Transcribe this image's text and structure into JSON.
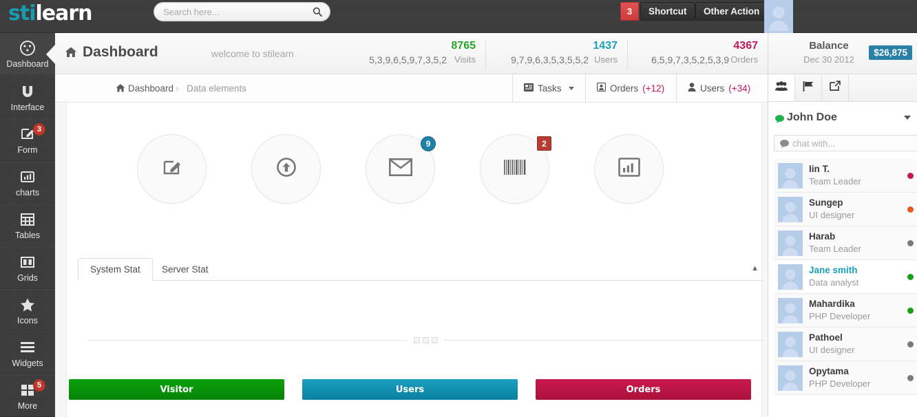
{
  "brand": {
    "part1": "sti",
    "part2": "learn",
    "accent": "#1a9cb0"
  },
  "topbar": {
    "search": {
      "placeholder": "Search here...",
      "value": ""
    },
    "notif_badge": "3",
    "shortcut_label": "Shortcut",
    "other_action_label": "Other Action"
  },
  "sidebar": {
    "items": [
      {
        "label": "Dashboard",
        "icon": "dashboard-icon",
        "badge": "",
        "active": true
      },
      {
        "label": "Interface",
        "icon": "magnet-icon",
        "badge": "",
        "active": false
      },
      {
        "label": "Form",
        "icon": "edit-icon",
        "badge": "3",
        "active": false
      },
      {
        "label": "charts",
        "icon": "bar-chart-icon",
        "badge": "",
        "active": false
      },
      {
        "label": "Tables",
        "icon": "table-icon",
        "badge": "",
        "active": false
      },
      {
        "label": "Grids",
        "icon": "grid-icon",
        "badge": "",
        "active": false
      },
      {
        "label": "Icons",
        "icon": "star-icon",
        "badge": "",
        "active": false
      },
      {
        "label": "Widgets",
        "icon": "list-icon",
        "badge": "",
        "active": false
      },
      {
        "label": "More",
        "icon": "blocks-icon",
        "badge": "5",
        "active": false
      }
    ]
  },
  "header": {
    "title": "Dashboard",
    "subtitle": "welcome to stilearn",
    "stats": [
      {
        "spark": "5,3,9,6,5,9,7,3,5,2",
        "number": "8765",
        "label": "Visits",
        "color": "#28a428"
      },
      {
        "spark": "9,7,9,6,3,5,3,5,5,2",
        "number": "1437",
        "label": "Users",
        "color": "#17a2b8"
      },
      {
        "spark": "6,5,9,7,3,5,2,5,3,9",
        "number": "4367",
        "label": "Orders",
        "color": "#c2185b"
      }
    ]
  },
  "breadcrumb": {
    "root": "Dashboard",
    "separator": "›",
    "current": "Data elements",
    "buttons": [
      {
        "label": "Tasks",
        "count": "",
        "icon": "tasks-icon",
        "caret": true
      },
      {
        "label": "Orders",
        "count": "(+12)",
        "icon": "orders-icon",
        "caret": false
      },
      {
        "label": "Users",
        "count": "(+34)",
        "icon": "user-icon",
        "caret": false
      }
    ]
  },
  "main": {
    "circles": [
      {
        "icon": "edit-square-icon",
        "badge": "",
        "badge_type": ""
      },
      {
        "icon": "upload-circle-icon",
        "badge": "",
        "badge_type": ""
      },
      {
        "icon": "envelope-icon",
        "badge": "9",
        "badge_type": "round"
      },
      {
        "icon": "barcode-icon",
        "badge": "2",
        "badge_type": "square"
      },
      {
        "icon": "chart-icon",
        "badge": "",
        "badge_type": ""
      }
    ],
    "carousel_dots": 3,
    "tabs": [
      {
        "label": "System Stat",
        "active": true
      },
      {
        "label": "Server Stat",
        "active": false
      }
    ],
    "collapse_caret": "▲",
    "buttons": [
      {
        "label": "Visitor",
        "color": "#0a9000"
      },
      {
        "label": "Users",
        "color": "#0e8fab"
      },
      {
        "label": "Orders",
        "color": "#b91543"
      }
    ]
  },
  "rightpanel": {
    "balance_title": "Balance",
    "balance_date": "Dec 30 2012",
    "balance_amount": "$26,875",
    "icon_tabs": [
      {
        "icon": "users-group-icon",
        "active": true
      },
      {
        "icon": "flag-icon",
        "active": false
      },
      {
        "icon": "external-link-icon",
        "active": false
      }
    ],
    "chat_user": "John Doe",
    "chat_input": {
      "placeholder": "chat with...",
      "value": ""
    },
    "contacts": [
      {
        "name": "Iin T.",
        "role": "Team Leader",
        "status": "#c2185b",
        "highlight": false,
        "shaded": true
      },
      {
        "name": "Sungep",
        "role": "UI designer",
        "status": "#e8571c",
        "highlight": false,
        "shaded": true
      },
      {
        "name": "Harab",
        "role": "Team Leader",
        "status": "#7a7a7a",
        "highlight": false,
        "shaded": true
      },
      {
        "name": "Jane smith",
        "role": "Data analyst",
        "status": "#18a018",
        "highlight": true,
        "shaded": false
      },
      {
        "name": "Mahardika",
        "role": "PHP Developer",
        "status": "#18a018",
        "highlight": false,
        "shaded": true
      },
      {
        "name": "Pathoel",
        "role": "UI designer",
        "status": "#7a7a7a",
        "highlight": false,
        "shaded": true
      },
      {
        "name": "Opytama",
        "role": "PHP Developer",
        "status": "#7a7a7a",
        "highlight": false,
        "shaded": true
      }
    ]
  }
}
